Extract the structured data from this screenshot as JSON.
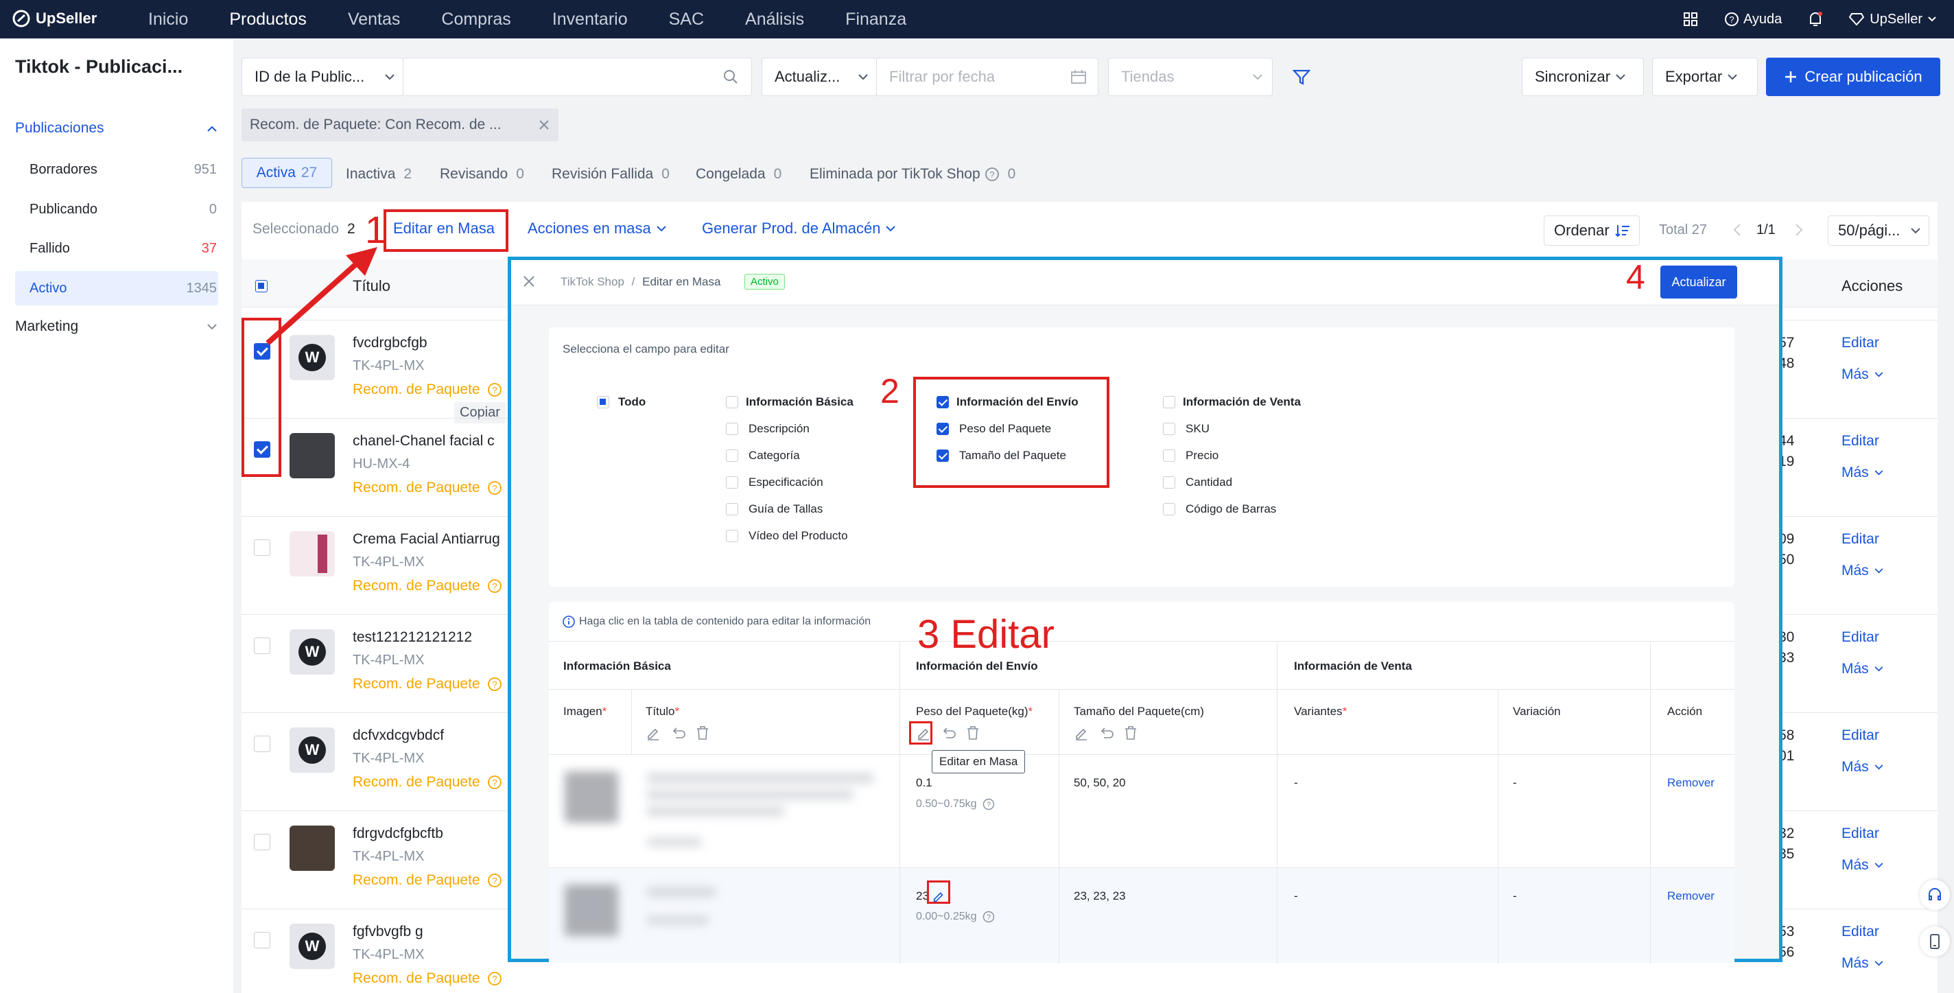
{
  "app": {
    "name": "UpSeller"
  },
  "topnav": {
    "menu": [
      "Inicio",
      "Productos",
      "Ventas",
      "Compras",
      "Inventario",
      "SAC",
      "Análisis",
      "Finanza"
    ],
    "help": "Ayuda",
    "user": "UpSeller"
  },
  "sidebar": {
    "title": "Tiktok - Publicaci...",
    "section1": "Publicaciones",
    "items": [
      {
        "label": "Borradores",
        "count": "951"
      },
      {
        "label": "Publicando",
        "count": "0"
      },
      {
        "label": "Fallido",
        "count": "37"
      },
      {
        "label": "Activo",
        "count": "1345"
      }
    ],
    "section2": "Marketing"
  },
  "filters": {
    "id_select": "ID de la Public...",
    "update_select": "Actualiz...",
    "date_placeholder": "Filtrar por fecha",
    "stores_placeholder": "Tiendas",
    "sync": "Sincronizar",
    "export": "Exportar",
    "create": "Crear publicación",
    "chip": "Recom. de Paquete: Con Recom. de ..."
  },
  "tabs": [
    {
      "label": "Activa",
      "count": "27"
    },
    {
      "label": "Inactiva",
      "count": "2"
    },
    {
      "label": "Revisando",
      "count": "0"
    },
    {
      "label": "Revisión Fallida",
      "count": "0"
    },
    {
      "label": "Congelada",
      "count": "0"
    },
    {
      "label": "Eliminada por TikTok Shop",
      "count": "0"
    }
  ],
  "actionbar": {
    "selected_label": "Seleccionado",
    "selected_count": "2",
    "bulk_edit": "Editar en Masa",
    "bulk_actions": "Acciones en masa",
    "gen_warehouse": "Generar Prod. de Almacén",
    "sort": "Ordenar",
    "total": "Total 27",
    "page": "1/1",
    "per_page": "50/pági..."
  },
  "table": {
    "col_title": "Título",
    "col_actions": "Acciones",
    "edit": "Editar",
    "more": "Más",
    "rec": "Recom. de Paquete",
    "copy_tip": "Copiar",
    "rows": [
      {
        "title": "fvcdrgbcfgb",
        "sku": "TK-4PL-MX",
        "n1": "57",
        "n2": "48",
        "checked": true
      },
      {
        "title": "chanel-Chanel facial c",
        "sku": "HU-MX-4",
        "n1": "44",
        "n2": "19",
        "checked": true
      },
      {
        "title": "Crema Facial Antiarrug",
        "sku": "TK-4PL-MX",
        "n1": "09",
        "n2": "50",
        "checked": false
      },
      {
        "title": "test121212121212",
        "sku": "TK-4PL-MX",
        "n1": "30",
        "n2": "33",
        "checked": false
      },
      {
        "title": "dcfvxdcgvbdcf",
        "sku": "TK-4PL-MX",
        "n1": "58",
        "n2": "01",
        "checked": false
      },
      {
        "title": "fdrgvdcfgbcftb",
        "sku": "TK-4PL-MX",
        "n1": "32",
        "n2": "35",
        "checked": false
      },
      {
        "title": "fgfvbvgfb g",
        "sku": "TK-4PL-MX",
        "n1": "53",
        "n2": "56",
        "checked": false
      }
    ]
  },
  "modal": {
    "breadcrumb1": "TikTok Shop",
    "breadcrumb2": "Editar en Masa",
    "status": "Activo",
    "update": "Actualizar",
    "select_field": "Selecciona el campo para editar",
    "all": "Todo",
    "basic": {
      "title": "Información Básica",
      "items": [
        "Descripción",
        "Categoría",
        "Especificación",
        "Guía de Tallas",
        "Vídeo del Producto"
      ]
    },
    "shipping": {
      "title": "Información del Envío",
      "items": [
        "Peso del Paquete",
        "Tamaño del Paquete"
      ]
    },
    "sales": {
      "title": "Información de Venta",
      "items": [
        "SKU",
        "Precio",
        "Cantidad",
        "Código de Barras"
      ]
    },
    "hint": "Haga clic en la tabla de contenido para editar la información",
    "groups": [
      "Información Básica",
      "Información del Envío",
      "Información de Venta"
    ],
    "cols": {
      "image": "Imagen",
      "title": "Título",
      "weight": "Peso del Paquete(kg)",
      "size": "Tamaño del Paquete(cm)",
      "variants": "Variantes",
      "variation": "Variación",
      "action": "Acción"
    },
    "tooltip": "Editar en Masa",
    "rows": [
      {
        "weight": "0.1",
        "range": "0.50~0.75kg",
        "size": "50, 50, 20",
        "variants": "-",
        "variation": "-",
        "action": "Remover"
      },
      {
        "weight": "23",
        "range": "0.00~0.25kg",
        "size": "23, 23, 23",
        "variants": "-",
        "variation": "-",
        "action": "Remover"
      }
    ]
  },
  "annotations": {
    "step1": "1",
    "step2": "2",
    "step3": "3 Editar",
    "step4": "4"
  },
  "colors": {
    "primary": "#1a56db",
    "nav": "#14213d",
    "warning": "#f7a600",
    "annotation": "#e02020",
    "modal_border": "#1a9bd7"
  }
}
